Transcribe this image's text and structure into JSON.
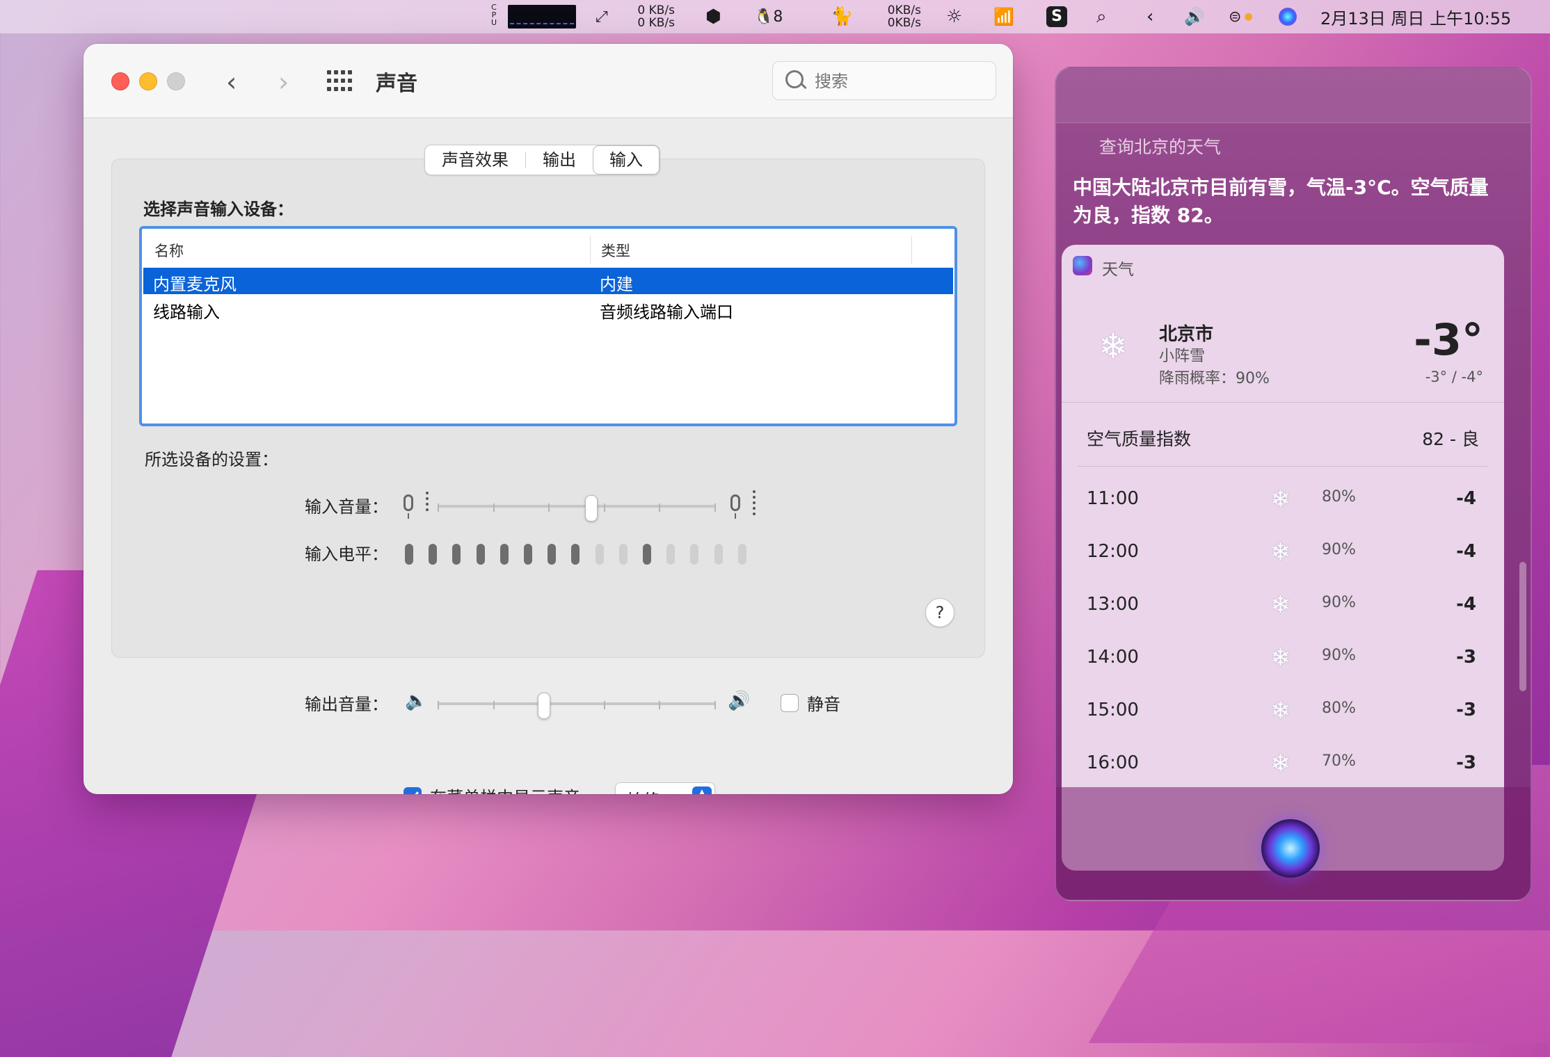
{
  "menubar": {
    "cpu_label": "CPU",
    "net1_up": "0 KB/s",
    "net1_down": "0 KB/s",
    "qq_badge": "8",
    "net2_up": "0KB/s",
    "net2_down": "0KB/s",
    "clock": "2月13日 周日 上午10:55"
  },
  "window": {
    "title": "声音",
    "search_placeholder": "搜索",
    "tabs": [
      "声音效果",
      "输出",
      "输入"
    ],
    "active_tab": "输入",
    "select_label": "选择声音输入设备：",
    "table": {
      "columns": [
        "名称",
        "类型"
      ],
      "rows": [
        {
          "name": "内置麦克风",
          "type": "内建",
          "selected": true
        },
        {
          "name": "线路输入",
          "type": "音频线路输入端口",
          "selected": false
        }
      ]
    },
    "settings_label": "所选设备的设置：",
    "input_volume_label": "输入音量：",
    "input_volume": 0.55,
    "input_level_label": "输入电平：",
    "input_level_active": 8,
    "input_level_total": 15,
    "help": "?",
    "output_volume_label": "输出音量：",
    "output_volume": 0.38,
    "mute_label": "静音",
    "show_in_menubar_label": "在菜单栏中显示声音",
    "show_option": "始终"
  },
  "siri": {
    "query": "查询北京的天气",
    "answer": "中国大陆北京市目前有雪，气温-3°C。空气质量为良，指数 82。",
    "card": {
      "app": "天气",
      "city": "北京市",
      "condition": "小阵雪",
      "rain_chance": "降雨概率：90%",
      "temp": "-3°",
      "hilo": "-3° / -4°",
      "aqi_label": "空气质量指数",
      "aqi_value": "82 - 良",
      "hourly": [
        {
          "time": "11:00",
          "pct": "80%",
          "temp": "-4"
        },
        {
          "time": "12:00",
          "pct": "90%",
          "temp": "-4"
        },
        {
          "time": "13:00",
          "pct": "90%",
          "temp": "-4"
        },
        {
          "time": "14:00",
          "pct": "90%",
          "temp": "-3"
        },
        {
          "time": "15:00",
          "pct": "80%",
          "temp": "-3"
        },
        {
          "time": "16:00",
          "pct": "70%",
          "temp": "-3"
        }
      ]
    }
  }
}
